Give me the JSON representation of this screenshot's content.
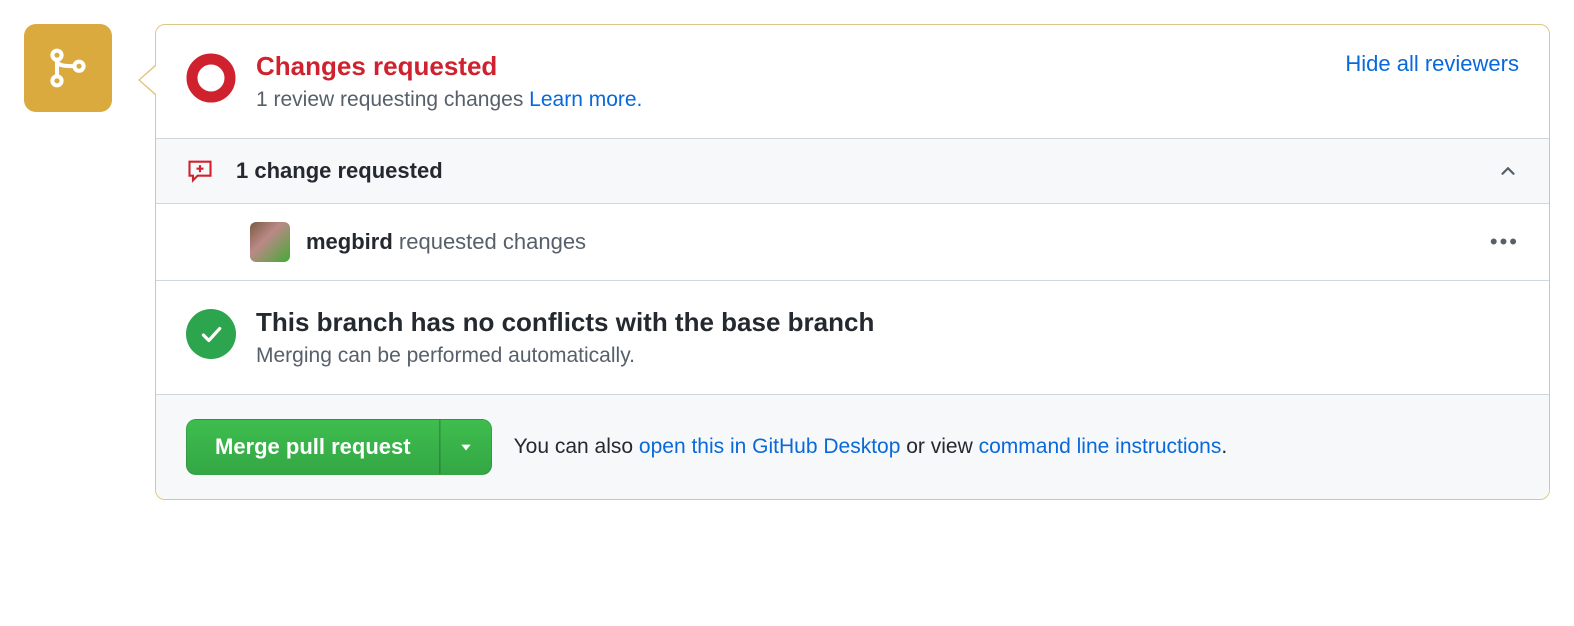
{
  "status": {
    "title": "Changes requested",
    "subtext": "1 review requesting changes ",
    "learn_more": "Learn more."
  },
  "hide_link": "Hide all reviewers",
  "summary": {
    "text": "1 change requested"
  },
  "reviewer": {
    "name": "megbird",
    "action": " requested changes"
  },
  "conflict": {
    "title": "This branch has no conflicts with the base branch",
    "subtext": "Merging can be performed automatically."
  },
  "merge": {
    "button": "Merge pull request",
    "hint_prefix": "You can also ",
    "desktop_link": "open this in GitHub Desktop",
    "hint_mid": " or view ",
    "cli_link": "command line instructions",
    "hint_suffix": "."
  }
}
